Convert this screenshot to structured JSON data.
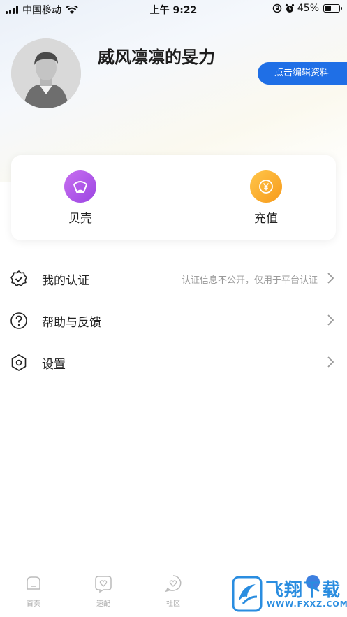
{
  "status_bar": {
    "carrier": "中国移动",
    "time": "上午 9:22",
    "battery": "45%",
    "battery_level": 0.45
  },
  "profile": {
    "username": "威风凛凛的旻力",
    "edit_label": "点击编辑资料"
  },
  "wallet": {
    "items": [
      {
        "label": "贝壳",
        "icon": "shell-icon",
        "color": "#b35ae9"
      },
      {
        "label": "充值",
        "icon": "yuan-icon",
        "color": "#f9a825"
      }
    ]
  },
  "menu": {
    "items": [
      {
        "label": "我的认证",
        "note": "认证信息不公开，仅用于平台认证",
        "icon": "verified-badge-icon"
      },
      {
        "label": "帮助与反馈",
        "note": "",
        "icon": "help-circle-icon"
      },
      {
        "label": "设置",
        "note": "",
        "icon": "hexagon-settings-icon"
      }
    ]
  },
  "bottom_nav": {
    "items": [
      {
        "label": "首页",
        "icon": "home-icon"
      },
      {
        "label": "速配",
        "icon": "heart-match-icon"
      },
      {
        "label": "社区",
        "icon": "heart-chat-icon"
      },
      {
        "label": "",
        "icon": "message-icon"
      },
      {
        "label": "",
        "icon": "profile-icon"
      }
    ]
  },
  "watermark": {
    "brand": "飞翔下载",
    "url": "WWW.FXXZ.COM"
  },
  "colors": {
    "accent": "#1f6fe6",
    "watermark": "#2a8de0"
  }
}
